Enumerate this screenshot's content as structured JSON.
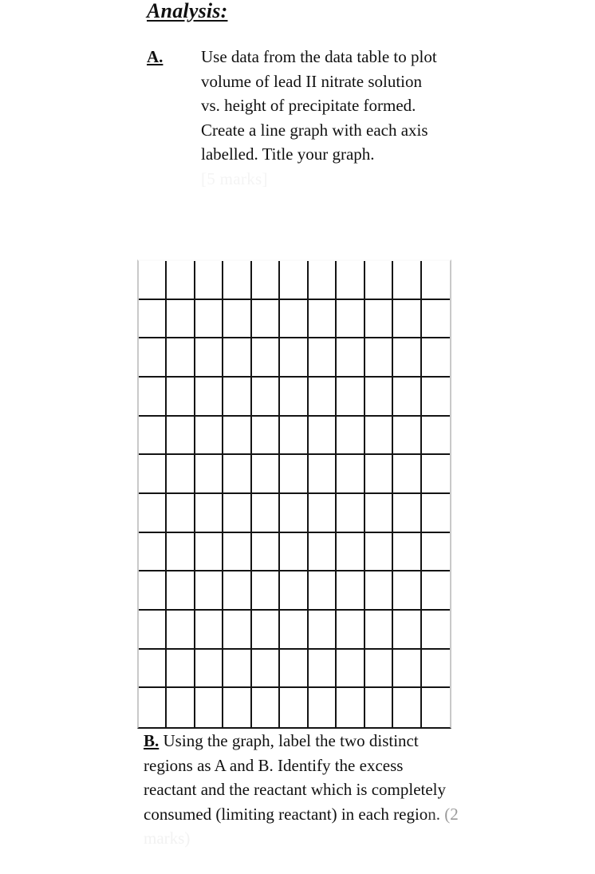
{
  "document": {
    "heading": "Analysis:",
    "background_color": "#ffffff",
    "text_color": "#111111"
  },
  "question_a": {
    "marker": "A.",
    "lines": [
      "Use data from the data",
      "table to plot volume of",
      "lead II nitrate solution vs.",
      "height of precipitate",
      "formed. Create a line",
      "graph with each axis",
      "labelled. Title your graph."
    ],
    "body_text": "Use data from the data table to plot volume of lead II nitrate solution vs. height of precipitate formed. Create a line graph with each axis labelled. Title your graph.",
    "marks": "[5 marks]",
    "marks_color": "#f4f4f4"
  },
  "graph_grid": {
    "columns": 11,
    "rows": 12,
    "line_color": "#141414",
    "edge_color": "#c9c9c9",
    "background": "#ffffff",
    "plot_title": "",
    "x_axis_label": "",
    "y_axis_label": "",
    "plotted_points": []
  },
  "chart_data": {
    "type": "line",
    "title": "",
    "xlabel": "",
    "ylabel": "",
    "grid": true,
    "legend": "none",
    "x": [],
    "series": [],
    "note": "Blank graph paper grid — 11 columns by 12 rows, no data plotted, no axis tick labels printed."
  },
  "question_b": {
    "marker": "B.",
    "line_1": " Using the graph, label the two",
    "line_2": "distinct regions as A and B.",
    "line_3": " Identify the excess reactant and",
    "line_4": "the reactant which is completely",
    "line_5_strong": "consumed (limiting reactant) in",
    "line_6_a": "each regio",
    "line_6_b": "n.",
    "line_6_c": "  (2",
    "line_6_d": " marks)",
    "body_text": "B. Using the graph, label the two distinct regions as A and B. Identify the excess reactant and the reactant which is completely consumed (limiting reactant) in each region. (2 marks)"
  }
}
